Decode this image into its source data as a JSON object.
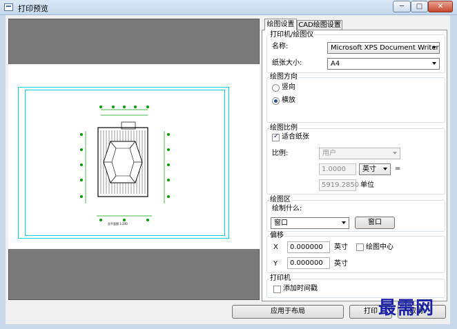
{
  "window": {
    "title": "打印预览",
    "icon": "app-icon",
    "controls": [
      "minimize-icon",
      "maximize-icon",
      "close-icon"
    ]
  },
  "tabs": [
    {
      "label": "绘图设置",
      "active": true
    },
    {
      "label": "CAD绘图设置",
      "active": false
    }
  ],
  "printer": {
    "group_title": "打印机/绘图仪",
    "name_label": "名称:",
    "name_value": "Microsoft XPS Document Writer",
    "paper_label": "纸张大小:",
    "paper_value": "A4"
  },
  "orientation": {
    "group_title": "绘图方向",
    "portrait": "竖向",
    "landscape": "横放",
    "selected": "landscape"
  },
  "scale": {
    "group_title": "绘图比例",
    "fit_label": "适合纸张",
    "fit_checked": true,
    "ratio_label": "比例:",
    "ratio_value": "用户",
    "value1": "1.0000",
    "unit_value": "英寸",
    "equals": "=",
    "value2": "5919.2850",
    "unit2_label": "单位"
  },
  "plot_area": {
    "group_title": "绘图区",
    "what_label": "绘制什么:",
    "what_value": "窗口",
    "window_button": "窗口"
  },
  "offset": {
    "group_title": "偏移",
    "x_label": "X",
    "x_value": "0.000000",
    "x_unit": "英寸",
    "center_label": "绘图中心",
    "center_checked": false,
    "y_label": "Y",
    "y_value": "0.000000",
    "y_unit": "英寸"
  },
  "printer_opts": {
    "group_title": "打印机",
    "timestamp_label": "添加时间戳",
    "timestamp_checked": false
  },
  "buttons": {
    "apply": "应用于布局",
    "print": "打印",
    "cancel_partial": "取消"
  },
  "watermark": "最需网",
  "drawing_caption": "总平面图 1:100",
  "colors": {
    "preview_bg": "#7a7a7a",
    "frame_cyan": "#00d6e6",
    "watermark": "#1b22a6"
  }
}
